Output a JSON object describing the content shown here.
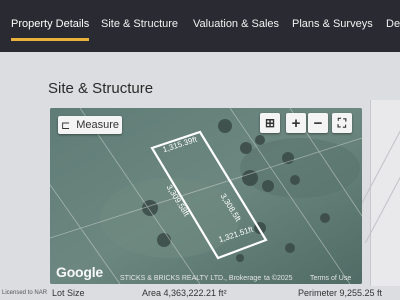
{
  "tabs": [
    {
      "label": "Property Details",
      "active": true
    },
    {
      "label": "Site & Structure",
      "active": false
    },
    {
      "label": "Valuation & Sales",
      "active": false
    },
    {
      "label": "Plans & Surveys",
      "active": false
    },
    {
      "label": "De",
      "active": false
    }
  ],
  "section": {
    "title": "Site & Structure"
  },
  "map": {
    "measure_label": "Measure",
    "controls": {
      "layers_icon": "map-layers-icon",
      "zoom_in": "+",
      "zoom_out": "−",
      "fullscreen_icon": "fullscreen-icon"
    },
    "dimensions": {
      "top": "1,315.39ft",
      "left": "3,309.58ft",
      "right": "3,308.5ft",
      "bottom": "1,321.51ft"
    },
    "provider_logo": "Google",
    "attribution": "STICKS & BRICKS REALTY LTD., Brokerage",
    "attribution_hidden": "ta ©2025",
    "terms": "Terms of Use"
  },
  "summary": {
    "lot_size_label": "Lot Size",
    "area_text": "Area 4,363,222.21 ft²",
    "perimeter_text": "Perimeter 9,255.25 ft"
  },
  "watermark": "Licensed to NAR"
}
